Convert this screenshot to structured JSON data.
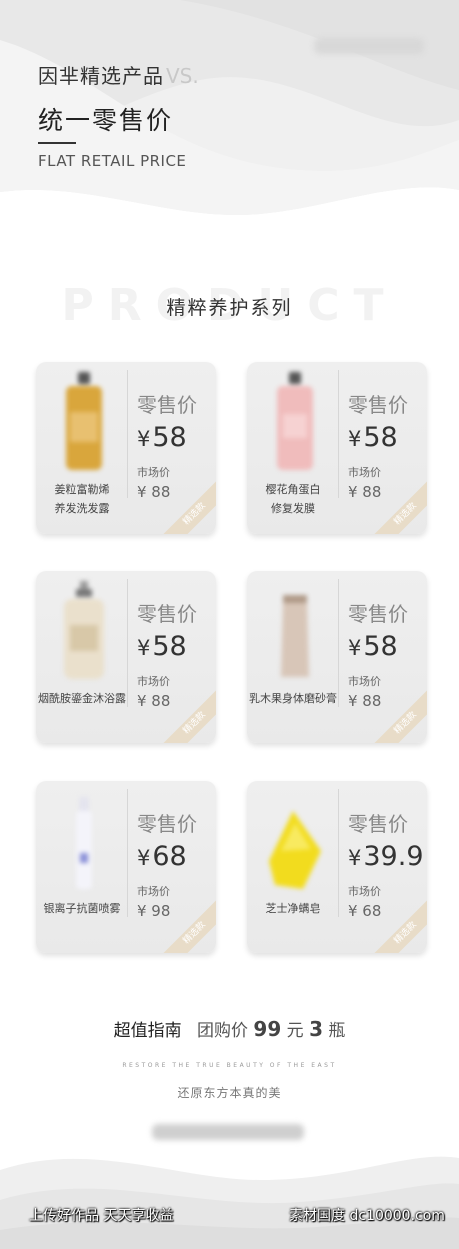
{
  "header": {
    "line1": "因芈精选产品",
    "vs": "VS.",
    "line2": "统一零售价",
    "line3": "FLAT RETAIL PRICE"
  },
  "section": {
    "bg_text": "PRODUCT",
    "title": "精粹养护系列"
  },
  "cards": [
    {
      "name1": "姜粒富勒烯",
      "name2": "养发洗发露",
      "label": "零售价",
      "currency": "¥",
      "price": "58",
      "market_label": "市场价",
      "market_price": "¥ 88",
      "ribbon": "精选款"
    },
    {
      "name1": "樱花角蛋白",
      "name2": "修复发膜",
      "label": "零售价",
      "currency": "¥",
      "price": "58",
      "market_label": "市场价",
      "market_price": "¥ 88",
      "ribbon": "精选款"
    },
    {
      "name1": "烟酰胺鎏金沐浴露",
      "name2": "",
      "label": "零售价",
      "currency": "¥",
      "price": "58",
      "market_label": "市场价",
      "market_price": "¥ 88",
      "ribbon": "精选款"
    },
    {
      "name1": "乳木果身体磨砂膏",
      "name2": "",
      "label": "零售价",
      "currency": "¥",
      "price": "58",
      "market_label": "市场价",
      "market_price": "¥ 88",
      "ribbon": "精选款"
    },
    {
      "name1": "银离子抗菌喷雾",
      "name2": "",
      "label": "零售价",
      "currency": "¥",
      "price": "68",
      "market_label": "市场价",
      "market_price": "¥ 98",
      "ribbon": "精选款"
    },
    {
      "name1": "芝士净螨皂",
      "name2": "",
      "label": "零售价",
      "currency": "¥",
      "price": "39.9",
      "market_label": "市场价",
      "market_price": "¥ 68",
      "ribbon": "精选款"
    }
  ],
  "guide": {
    "label": "超值指南",
    "group_label": "团购价",
    "price": "99",
    "unit": "元",
    "count": "3",
    "count_unit": "瓶"
  },
  "restore": "RESTORE THE TRUE BEAUTY OF THE EAST",
  "slogan": "还原东方本真的美",
  "watermark": {
    "left": "上传好作品 天天享收益",
    "right": "素材国度 dc10000.com"
  }
}
